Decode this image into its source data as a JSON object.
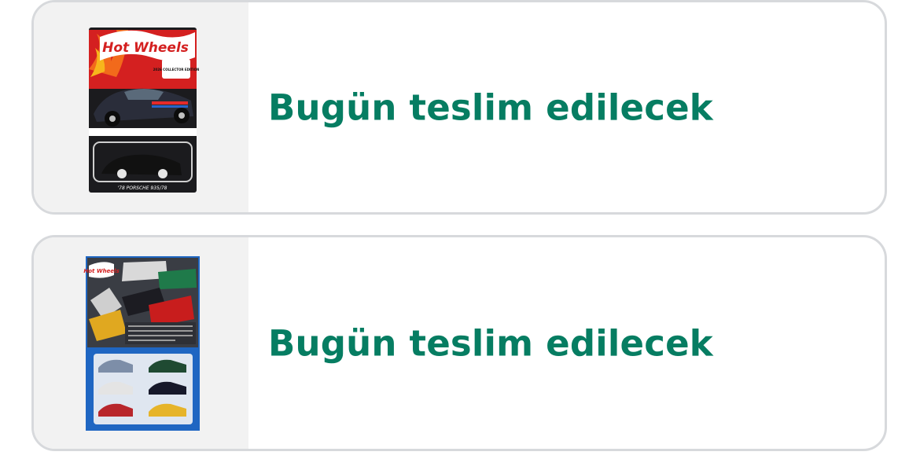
{
  "items": [
    {
      "brand_logo_text": "Hot Wheels",
      "edition_text": "2026 COLLECTOR EDITION",
      "car_name_text": "'78 PORSCHE 935/78",
      "delivery_status": "Bugün teslim edilecek"
    },
    {
      "brand_logo_text": "Hot Wheels",
      "delivery_status": "Bugün teslim edilecek"
    }
  ],
  "colors": {
    "delivery_status": "#067d62",
    "card_border": "#d7d9dc",
    "thumb_bg": "#f2f2f2"
  }
}
